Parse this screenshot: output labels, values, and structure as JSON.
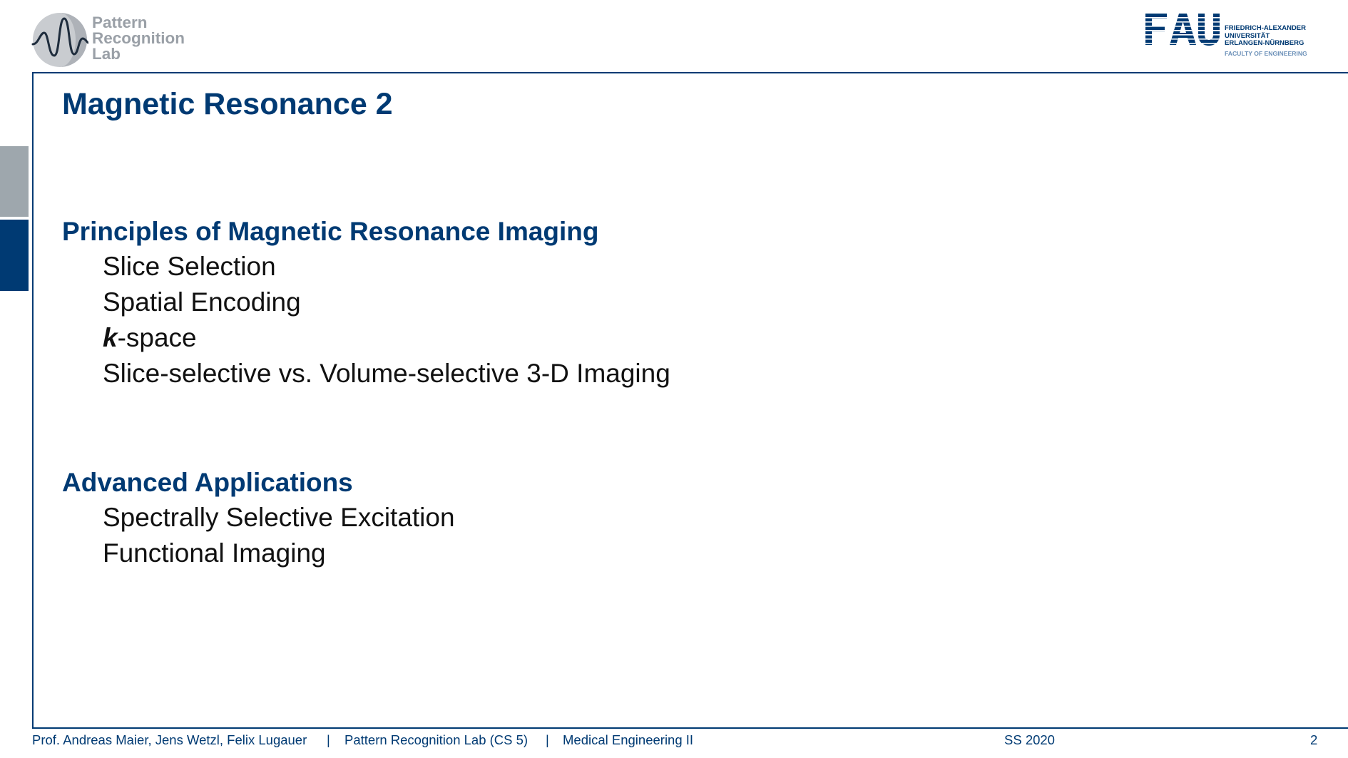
{
  "header": {
    "lab_logo": {
      "line1": "Pattern",
      "line2": "Recognition",
      "line3": "Lab"
    },
    "university_logo": {
      "mark": "FAU",
      "line1": "FRIEDRICH-ALEXANDER",
      "line2": "UNIVERSITÄT",
      "line3": "ERLANGEN-NÜRNBERG",
      "faculty": "FACULTY OF ENGINEERING"
    }
  },
  "slide": {
    "title": "Magnetic Resonance 2",
    "sections": [
      {
        "heading": "Principles of Magnetic Resonance Imaging",
        "items": [
          "Slice Selection",
          "Spatial Encoding",
          "-space",
          "Slice-selective vs. Volume-selective 3-D Imaging"
        ],
        "k_symbol": "k"
      },
      {
        "heading": "Advanced Applications",
        "items": [
          "Spectrally Selective Excitation",
          "Functional Imaging"
        ]
      }
    ]
  },
  "footer": {
    "authors": "Prof. Andreas Maier, Jens Wetzl, Felix Lugauer",
    "separator": "|",
    "lab": "Pattern Recognition Lab (CS 5)",
    "course": "Medical Engineering II",
    "semester": "SS 2020",
    "page_number": "2"
  },
  "colors": {
    "brand_blue": "#003a73",
    "grey": "#9ea7ad",
    "text": "#111111"
  }
}
